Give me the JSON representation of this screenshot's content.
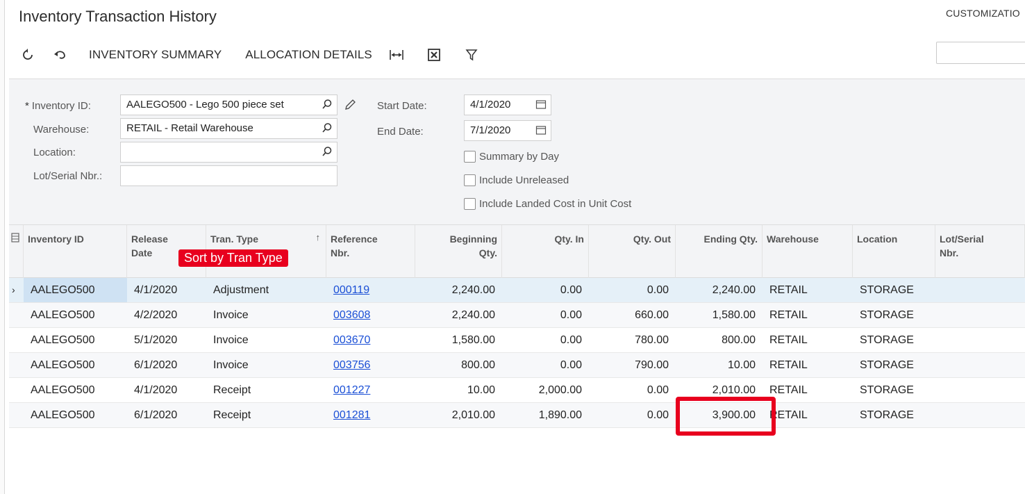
{
  "header": {
    "title": "Inventory Transaction History",
    "customization": "CUSTOMIZATIO"
  },
  "toolbar": {
    "refresh_icon": "refresh-icon",
    "undo_icon": "undo-icon",
    "inventory_summary": "INVENTORY SUMMARY",
    "allocation_details": "ALLOCATION DETAILS",
    "fit_columns_icon": "fit-columns-icon",
    "excel_icon": "excel-export-icon",
    "filter_icon": "filter-icon"
  },
  "search": {
    "placeholder": ""
  },
  "form": {
    "inventory_id_label": "Inventory ID:",
    "inventory_id_value": "AALEGO500 - Lego 500 piece set",
    "warehouse_label": "Warehouse:",
    "warehouse_value": "RETAIL - Retail Warehouse",
    "location_label": "Location:",
    "location_value": "",
    "lot_serial_label": "Lot/Serial Nbr.:",
    "lot_serial_value": "",
    "start_date_label": "Start Date:",
    "start_date_value": "4/1/2020",
    "end_date_label": "End Date:",
    "end_date_value": "7/1/2020",
    "summary_by_day": "Summary by Day",
    "include_unreleased": "Include Unreleased",
    "include_landed_cost": "Include Landed Cost in Unit Cost"
  },
  "grid": {
    "headers": {
      "inventory_id": "Inventory ID",
      "release_date": [
        "Release",
        "Date"
      ],
      "tran_type": "Tran. Type",
      "reference_nbr": [
        "Reference",
        "Nbr."
      ],
      "beginning_qty": [
        "Beginning",
        "Qty."
      ],
      "qty_in": "Qty. In",
      "qty_out": "Qty. Out",
      "ending_qty": "Ending Qty.",
      "warehouse": "Warehouse",
      "location": "Location",
      "lot_serial": [
        "Lot/Serial",
        "Nbr."
      ]
    },
    "rows": [
      {
        "inventory_id": "AALEGO500",
        "release_date": "4/1/2020",
        "tran_type": "Adjustment",
        "reference_nbr": "000119",
        "beginning_qty": "2,240.00",
        "qty_in": "0.00",
        "qty_out": "0.00",
        "ending_qty": "2,240.00",
        "warehouse": "RETAIL",
        "location": "STORAGE"
      },
      {
        "inventory_id": "AALEGO500",
        "release_date": "4/2/2020",
        "tran_type": "Invoice",
        "reference_nbr": "003608",
        "beginning_qty": "2,240.00",
        "qty_in": "0.00",
        "qty_out": "660.00",
        "ending_qty": "1,580.00",
        "warehouse": "RETAIL",
        "location": "STORAGE"
      },
      {
        "inventory_id": "AALEGO500",
        "release_date": "5/1/2020",
        "tran_type": "Invoice",
        "reference_nbr": "003670",
        "beginning_qty": "1,580.00",
        "qty_in": "0.00",
        "qty_out": "780.00",
        "ending_qty": "800.00",
        "warehouse": "RETAIL",
        "location": "STORAGE"
      },
      {
        "inventory_id": "AALEGO500",
        "release_date": "6/1/2020",
        "tran_type": "Invoice",
        "reference_nbr": "003756",
        "beginning_qty": "800.00",
        "qty_in": "0.00",
        "qty_out": "790.00",
        "ending_qty": "10.00",
        "warehouse": "RETAIL",
        "location": "STORAGE"
      },
      {
        "inventory_id": "AALEGO500",
        "release_date": "4/1/2020",
        "tran_type": "Receipt",
        "reference_nbr": "001227",
        "beginning_qty": "10.00",
        "qty_in": "2,000.00",
        "qty_out": "0.00",
        "ending_qty": "2,010.00",
        "warehouse": "RETAIL",
        "location": "STORAGE"
      },
      {
        "inventory_id": "AALEGO500",
        "release_date": "6/1/2020",
        "tran_type": "Receipt",
        "reference_nbr": "001281",
        "beginning_qty": "2,010.00",
        "qty_in": "1,890.00",
        "qty_out": "0.00",
        "ending_qty": "3,900.00",
        "warehouse": "RETAIL",
        "location": "STORAGE"
      }
    ]
  },
  "annotation": {
    "sort_badge": "Sort by Tran Type",
    "accent_color": "#e8001e"
  }
}
